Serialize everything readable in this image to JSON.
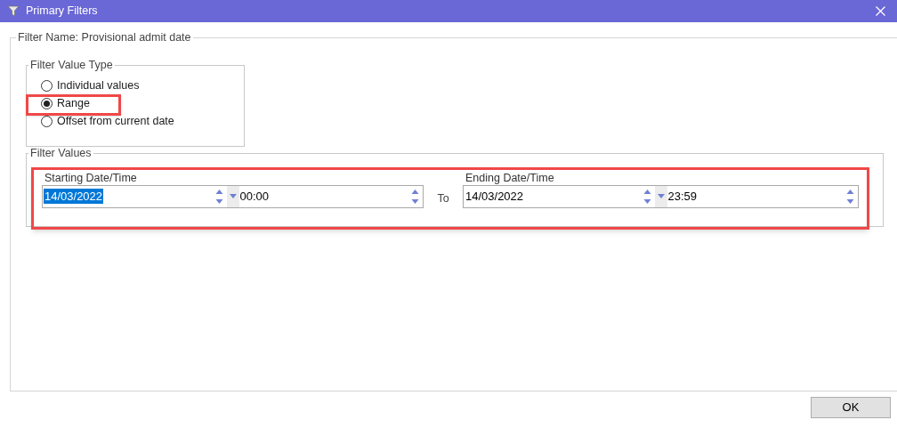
{
  "window": {
    "title": "Primary Filters"
  },
  "filter_name": "Filter Name: Provisional admit date",
  "value_type": {
    "title": "Filter Value Type",
    "options": [
      {
        "label": "Individual values",
        "selected": false
      },
      {
        "label": "Range",
        "selected": true
      },
      {
        "label": "Offset from current date",
        "selected": false
      }
    ]
  },
  "filter_values": {
    "title": "Filter Values",
    "start": {
      "label": "Starting Date/Time",
      "date": "14/03/2022",
      "time": "00:00",
      "date_selected": true
    },
    "separator": "To",
    "end": {
      "label": "Ending Date/Time",
      "date": "14/03/2022",
      "time": "23:59",
      "date_selected": false
    }
  },
  "buttons": [
    {
      "label": "OK"
    }
  ]
}
